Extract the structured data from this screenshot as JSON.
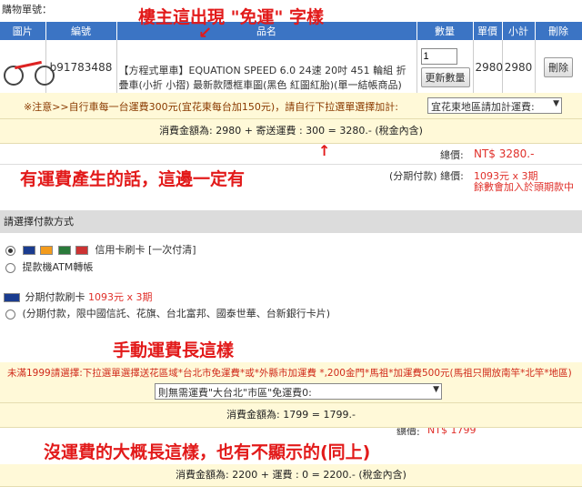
{
  "title": "購物單號：",
  "headers": [
    "圖片",
    "編號",
    "品名",
    "數量",
    "單價",
    "小計",
    "刪除"
  ],
  "item": {
    "code": "b91783488",
    "name": "【方程式單車】EQUATION SPEED 6.0 24速 20吋 451 輪組 折疊車(小折 小摺) 最新款隱框車圖(黑色 紅圖紅胎)(單一結帳商品)",
    "qty": "1",
    "update_label": "更新數量",
    "price": "2980",
    "subtotal": "2980",
    "delete_label": "刪除"
  },
  "annotations": {
    "top": "樓主這出現 \"免運\" 字樣",
    "middle": "有運費產生的話，這邊一定有",
    "manual": "手動運費長這樣",
    "bottom": "沒運費的大概長這樣，也有不顯示的(同上)"
  },
  "note": {
    "text": "※注意>>自行車每一台運費300元(宜花東每台加150元)，請自行下拉選單選擇加計:",
    "select_value": "宜花東地區請加計運費:"
  },
  "total1": "消費金額為: 2980 + 寄送運費 : 300 = 3280.- (稅金內含)",
  "summary": {
    "total_label": "總價:",
    "total_value": "NT$ 3280.-",
    "install_label": "(分期付款) 總價:",
    "install_value": "1093元 x 3期",
    "install_note": "餘數會加入於頭期款中"
  },
  "payment": {
    "header": "請選擇付款方式",
    "credit_label": "信用卡刷卡 [一次付清]",
    "atm_label": "提款機ATM轉帳",
    "install_card_label": "分期付款刷卡",
    "install_card_value": "1093元 x 3期",
    "install_banks": "(分期付款，限中國信託、花旗、台北富邦、國泰世華、台新銀行卡片)"
  },
  "manual": {
    "text": "未滿1999請選擇:下拉選單選擇送花區域*台北市免運費*或*外縣市加運費 *,200金門*馬祖*加運費500元(馬祖只開放南竿*北竿*地區)",
    "select_value": "則無需運費\"大台北\"市區\"免運費0:"
  },
  "total2": "消費金額為: 1799 = 1799.-",
  "partial_total": "NT$ 1799",
  "partial_label": "總價:",
  "total3": "消費金額為: 2200 + 運費 : 0 = 2200.- (稅金內含)",
  "colors": {
    "header_bg": "#3b74c4",
    "note_bg": "#fff9d8",
    "annotation": "#e21a1a",
    "price_red": "#e0302a"
  }
}
